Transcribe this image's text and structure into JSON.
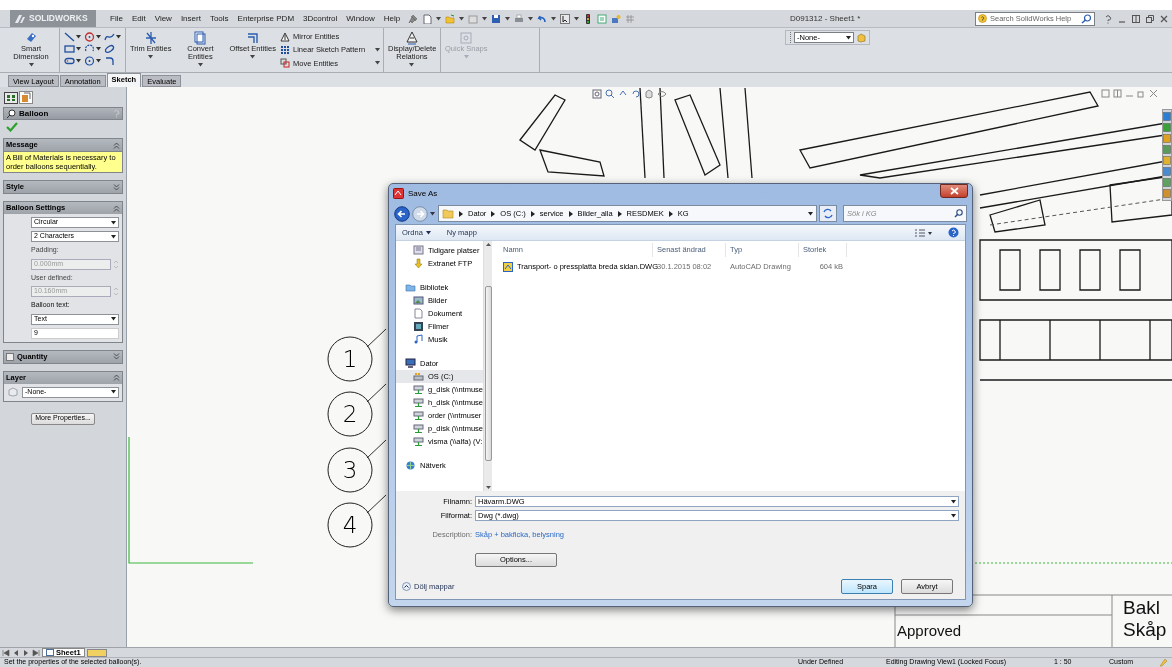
{
  "window": {
    "title": "D091312 - Sheet1 *",
    "brand": "SOLIDWORKS"
  },
  "menu": [
    "File",
    "Edit",
    "View",
    "Insert",
    "Tools",
    "Enterprise PDM",
    "3Dcontrol",
    "Window",
    "Help"
  ],
  "help_search": {
    "placeholder": "Search SolidWorks Help"
  },
  "ribbon": {
    "groups": [
      [
        {
          "kind": "large",
          "label": "Smart Dimension",
          "disabled": false
        }
      ],
      [
        {
          "kind": "large",
          "label": "Trim Entities",
          "disabled": false
        },
        {
          "kind": "large",
          "label": "Convert Entities",
          "disabled": false
        },
        {
          "kind": "large",
          "label": "Offset Entities",
          "disabled": false
        },
        {
          "kind": "small",
          "label": "Mirror Entities",
          "disabled": false
        },
        {
          "kind": "small",
          "label": "Linear Sketch Pattern",
          "disabled": false
        },
        {
          "kind": "small",
          "label": "Move Entities",
          "disabled": false
        }
      ],
      [
        {
          "kind": "large",
          "label": "Display/Delete Relations",
          "disabled": false
        }
      ],
      [
        {
          "kind": "large",
          "label": "Quick Snaps",
          "disabled": true
        }
      ]
    ]
  },
  "layer_toolbar": {
    "value": "-None-"
  },
  "tabs": [
    {
      "label": "View Layout",
      "selected": false
    },
    {
      "label": "Annotation",
      "selected": false
    },
    {
      "label": "Sketch",
      "selected": true
    },
    {
      "label": "Evaluate",
      "selected": false
    }
  ],
  "property_manager": {
    "title": "Balloon",
    "sections": [
      {
        "kind": "message",
        "title": "Message",
        "expanded": true,
        "text": "A Bill of Materials is necessary to order balloons sequentially."
      },
      {
        "kind": "plain",
        "title": "Style",
        "expanded": false
      },
      {
        "kind": "settings",
        "title": "Balloon Settings",
        "expanded": true,
        "fields": [
          {
            "kind": "select",
            "value": "Circular"
          },
          {
            "kind": "select",
            "value": "2 Characters"
          },
          {
            "kind": "spin",
            "label": "Padding:",
            "value": "0.000mm",
            "disabled": true
          },
          {
            "kind": "spin",
            "label": "User defined:",
            "value": "10.160mm",
            "disabled": true
          },
          {
            "kind": "select",
            "label": "Balloon text:",
            "value": "Text"
          },
          {
            "kind": "text",
            "value": "9"
          }
        ]
      },
      {
        "kind": "check",
        "title": "Quantity",
        "checked": false,
        "expanded": false
      },
      {
        "kind": "layer",
        "title": "Layer",
        "expanded": true,
        "value": "-None-"
      }
    ],
    "more_button": "More Properties..."
  },
  "drawing": {
    "balloons": [
      "1",
      "2",
      "3",
      "4"
    ],
    "approved": "Approved",
    "title_lines": [
      "Bakl",
      "Skåp"
    ]
  },
  "dialog": {
    "title": "Save As",
    "path": [
      "Dator",
      "OS (C:)",
      "service",
      "Bilder_alla",
      "RESDMEK",
      "KG"
    ],
    "search_placeholder": "Sök i KG",
    "toolbar": [
      {
        "label": "Ordna",
        "menu": true
      },
      {
        "label": "Ny mapp",
        "menu": false
      }
    ],
    "nav": [
      {
        "children": [
          {
            "kind": "recent",
            "label": "Tidigare platser",
            "selected": false
          },
          {
            "kind": "ftp",
            "label": "Extranet FTP",
            "selected": false
          }
        ]
      },
      {
        "kind": "library",
        "label": "Bibliotek",
        "selected": false,
        "children": [
          {
            "kind": "pictures",
            "label": "Bilder",
            "selected": false
          },
          {
            "kind": "documents",
            "label": "Dokument",
            "selected": false
          },
          {
            "kind": "videos",
            "label": "Filmer",
            "selected": false
          },
          {
            "kind": "music",
            "label": "Musik",
            "selected": false
          }
        ]
      },
      {
        "kind": "computer",
        "label": "Dator",
        "selected": false,
        "children": [
          {
            "kind": "drive",
            "label": "OS (C:)",
            "selected": true
          },
          {
            "kind": "network_drive",
            "label": "g_disk (\\\\ntmuse",
            "selected": false
          },
          {
            "kind": "network_drive",
            "label": "h_disk (\\\\ntmuse",
            "selected": false
          },
          {
            "kind": "network_drive",
            "label": "order (\\\\ntmuser",
            "selected": false
          },
          {
            "kind": "network_drive",
            "label": "p_disk (\\\\ntmuse",
            "selected": false
          },
          {
            "kind": "network_drive",
            "label": "visma (\\\\alfa) (V:",
            "selected": false
          }
        ]
      },
      {
        "kind": "network",
        "label": "Nätverk",
        "selected": false
      }
    ],
    "columns": [
      "Namn",
      "Senast ändrad",
      "Typ",
      "Storlek"
    ],
    "files": [
      {
        "name": "Transport- o pressplatta breda sidan.DWG",
        "modified": "30.1.2015 08:02",
        "type": "AutoCAD Drawing",
        "size": "604 kB"
      }
    ],
    "filename_label": "Filnamn:",
    "filename": "Hävarm.DWG",
    "format_label": "Filformat:",
    "format": "Dwg (*.dwg)",
    "description_label": "Description:",
    "description": "Skåp + bakficka, belysning",
    "options_button": "Options...",
    "hide_folders": "Dölj mappar",
    "save_button": "Spara",
    "cancel_button": "Avbryt"
  },
  "sheet_tabs": [
    {
      "label": "Sheet1",
      "selected": true
    }
  ],
  "status_bar": {
    "message": "Set the properties of the selected balloon(s).",
    "items": [
      "Under Defined",
      "Editing Drawing View1 (Locked Focus)",
      "1 : 50",
      "Custom"
    ]
  }
}
